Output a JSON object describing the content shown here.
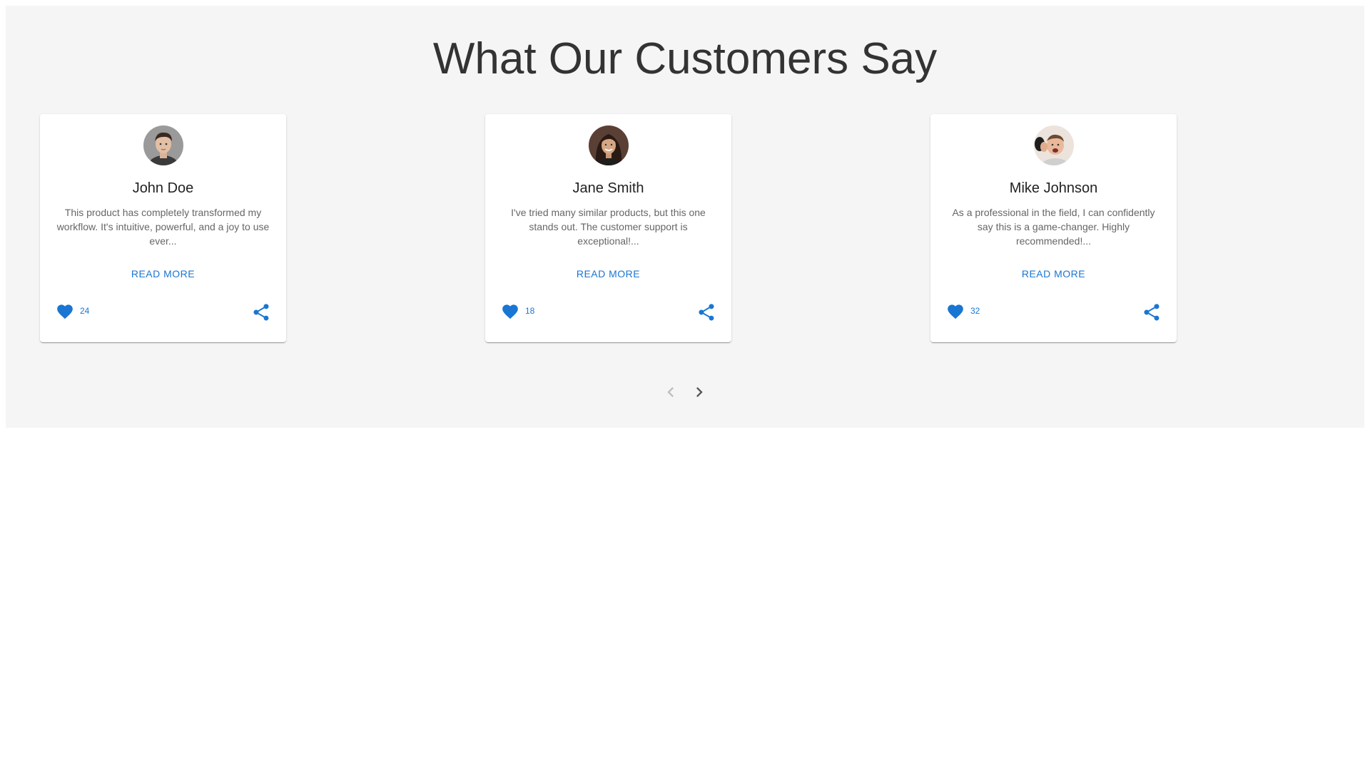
{
  "section": {
    "title": "What Our Customers Say"
  },
  "testimonials": [
    {
      "name": "John Doe",
      "text": "This product has completely transformed my workflow. It's intuitive, powerful, and a joy to use ever...",
      "read_more_label": "READ MORE",
      "likes": "24"
    },
    {
      "name": "Jane Smith",
      "text": "I've tried many similar products, but this one stands out. The customer support is exceptional!...",
      "read_more_label": "READ MORE",
      "likes": "18"
    },
    {
      "name": "Mike Johnson",
      "text": "As a professional in the field, I can confidently say this is a game-changer. Highly recommended!...",
      "read_more_label": "READ MORE",
      "likes": "32"
    }
  ],
  "icons": {
    "like": "heart-icon",
    "share": "share-icon",
    "prev": "chevron-left-icon",
    "next": "chevron-right-icon"
  },
  "colors": {
    "accent": "#1976d2",
    "section_background": "#f5f5f5",
    "heading": "#333333",
    "body_text": "#666666",
    "prev_disabled": "#bdbdbd",
    "next_enabled": "#555555"
  }
}
